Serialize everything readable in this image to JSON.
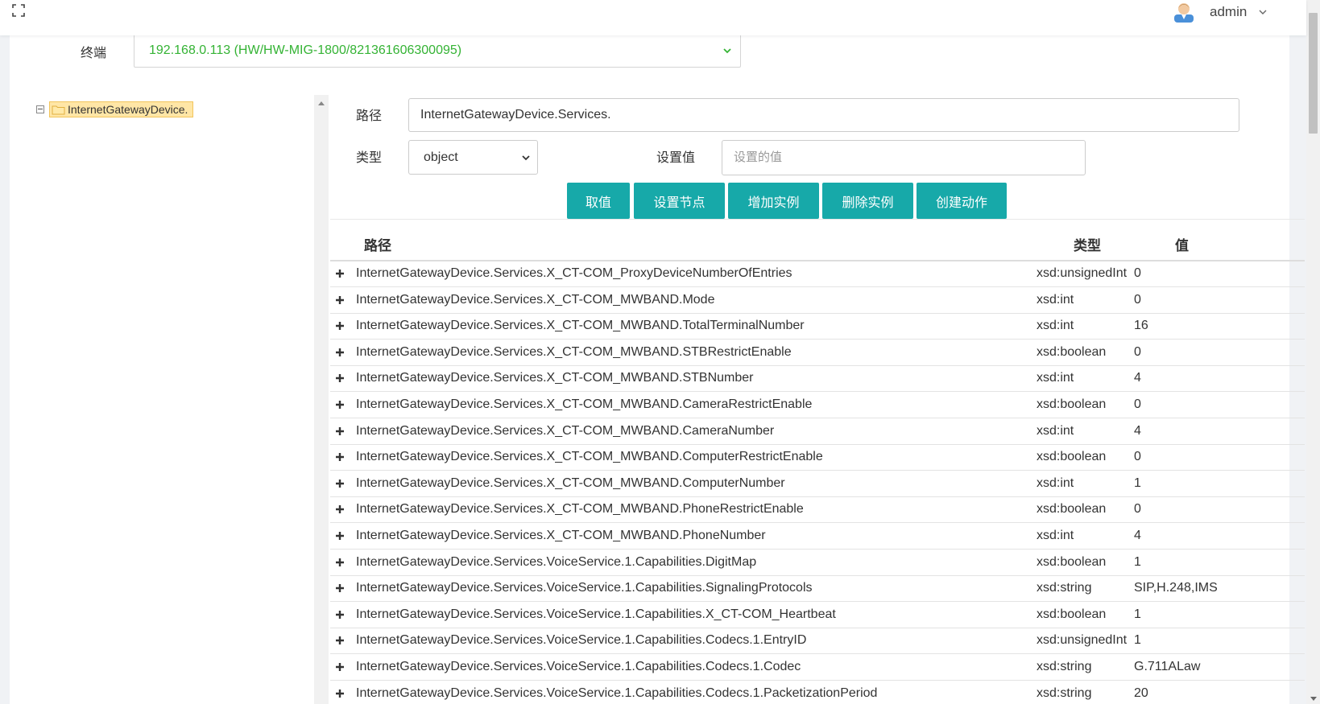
{
  "header": {
    "username": "admin"
  },
  "terminal": {
    "label": "终端",
    "selected": "192.168.0.113 (HW/HW-MIG-1800/821361606300095)"
  },
  "tree": {
    "root": "InternetGatewayDevice."
  },
  "form": {
    "path_label": "路径",
    "path_value": "InternetGatewayDevice.Services.",
    "type_label": "类型",
    "type_selected": "object",
    "value_label": "设置值",
    "value_placeholder": "设置的值"
  },
  "buttons": {
    "get": "取值",
    "set_node": "设置节点",
    "add_instance": "增加实例",
    "delete_instance": "删除实例",
    "create_action": "创建动作"
  },
  "table": {
    "headers": {
      "path": "路径",
      "type": "类型",
      "value": "值"
    },
    "rows": [
      {
        "path": "InternetGatewayDevice.Services.X_CT-COM_ProxyDeviceNumberOfEntries",
        "type": "xsd:unsignedInt",
        "value": "0"
      },
      {
        "path": "InternetGatewayDevice.Services.X_CT-COM_MWBAND.Mode",
        "type": "xsd:int",
        "value": "0"
      },
      {
        "path": "InternetGatewayDevice.Services.X_CT-COM_MWBAND.TotalTerminalNumber",
        "type": "xsd:int",
        "value": "16"
      },
      {
        "path": "InternetGatewayDevice.Services.X_CT-COM_MWBAND.STBRestrictEnable",
        "type": "xsd:boolean",
        "value": "0"
      },
      {
        "path": "InternetGatewayDevice.Services.X_CT-COM_MWBAND.STBNumber",
        "type": "xsd:int",
        "value": "4"
      },
      {
        "path": "InternetGatewayDevice.Services.X_CT-COM_MWBAND.CameraRestrictEnable",
        "type": "xsd:boolean",
        "value": "0"
      },
      {
        "path": "InternetGatewayDevice.Services.X_CT-COM_MWBAND.CameraNumber",
        "type": "xsd:int",
        "value": "4"
      },
      {
        "path": "InternetGatewayDevice.Services.X_CT-COM_MWBAND.ComputerRestrictEnable",
        "type": "xsd:boolean",
        "value": "0"
      },
      {
        "path": "InternetGatewayDevice.Services.X_CT-COM_MWBAND.ComputerNumber",
        "type": "xsd:int",
        "value": "1"
      },
      {
        "path": "InternetGatewayDevice.Services.X_CT-COM_MWBAND.PhoneRestrictEnable",
        "type": "xsd:boolean",
        "value": "0"
      },
      {
        "path": "InternetGatewayDevice.Services.X_CT-COM_MWBAND.PhoneNumber",
        "type": "xsd:int",
        "value": "4"
      },
      {
        "path": "InternetGatewayDevice.Services.VoiceService.1.Capabilities.DigitMap",
        "type": "xsd:boolean",
        "value": "1"
      },
      {
        "path": "InternetGatewayDevice.Services.VoiceService.1.Capabilities.SignalingProtocols",
        "type": "xsd:string",
        "value": "SIP,H.248,IMS"
      },
      {
        "path": "InternetGatewayDevice.Services.VoiceService.1.Capabilities.X_CT-COM_Heartbeat",
        "type": "xsd:boolean",
        "value": "1"
      },
      {
        "path": "InternetGatewayDevice.Services.VoiceService.1.Capabilities.Codecs.1.EntryID",
        "type": "xsd:unsignedInt",
        "value": "1"
      },
      {
        "path": "InternetGatewayDevice.Services.VoiceService.1.Capabilities.Codecs.1.Codec",
        "type": "xsd:string",
        "value": "G.711ALaw"
      },
      {
        "path": "InternetGatewayDevice.Services.VoiceService.1.Capabilities.Codecs.1.PacketizationPeriod",
        "type": "xsd:string",
        "value": "20"
      }
    ]
  },
  "colors": {
    "accent": "#17a9a9",
    "terminal_text": "#34b334"
  }
}
